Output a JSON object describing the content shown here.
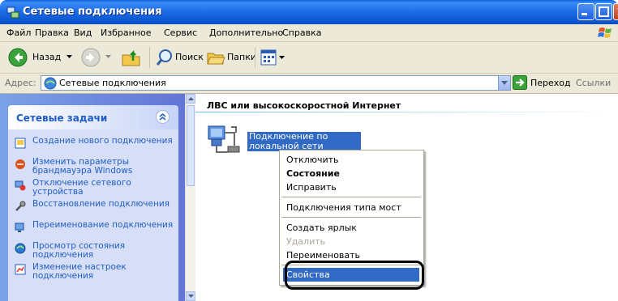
{
  "window": {
    "title": "Сетевые подключения"
  },
  "menubar": {
    "items": [
      "Файл",
      "Правка",
      "Вид",
      "Избранное",
      "Сервис",
      "Дополнительно",
      "Справка"
    ]
  },
  "toolbar": {
    "back_label": "Назад",
    "search_label": "Поиск",
    "folders_label": "Папки"
  },
  "address": {
    "label": "Адрес:",
    "value": "Сетевые подключения",
    "go_label": "Переход",
    "links_label": "Ссылки"
  },
  "sidebar": {
    "header": "Сетевые задачи",
    "tasks": [
      {
        "label": "Создание нового подключения",
        "icon": "new-connection-icon"
      },
      {
        "label": "Изменить параметры брандмауэра Windows",
        "icon": "firewall-icon"
      },
      {
        "label": "Отключение сетевого устройства",
        "icon": "disable-device-icon"
      },
      {
        "label": "Восстановление подключения",
        "icon": "repair-icon"
      },
      {
        "label": "Переименование подключения",
        "icon": "rename-icon"
      },
      {
        "label": "Просмотр состояния подключения",
        "icon": "status-icon"
      },
      {
        "label": "Изменение настроек подключения",
        "icon": "settings-icon"
      }
    ]
  },
  "content": {
    "group_title": "ЛВС или высокоскоростной Интернет",
    "connection_label": "Подключение по локальной сети"
  },
  "context_menu": {
    "items": [
      "Отключить",
      "Состояние",
      "Исправить",
      "Подключения типа мост",
      "Создать ярлык",
      "Удалить",
      "Переименовать",
      "Свойства"
    ]
  },
  "colors": {
    "titlebar": "#0a5fd8",
    "selection": "#316ac5",
    "task_link": "#215dc6"
  }
}
